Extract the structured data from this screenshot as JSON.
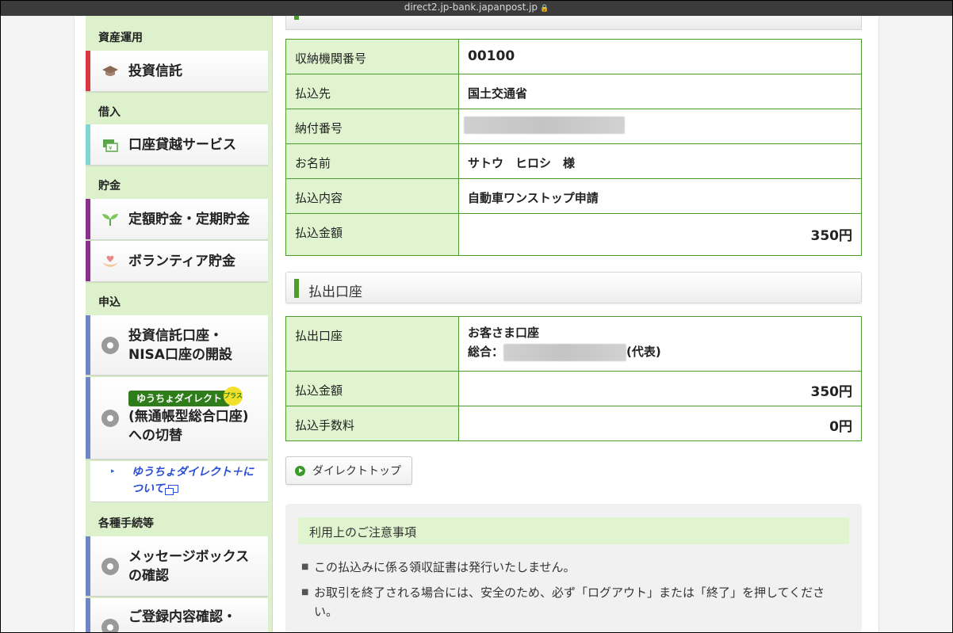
{
  "browser": {
    "url": "direct2.jp-bank.japanpost.jp"
  },
  "sidebar": {
    "sections": {
      "investment": "資産運用",
      "loan": "借入",
      "savings": "貯金",
      "apply": "申込",
      "procedures": "各種手続等"
    },
    "items": {
      "investment_trust": "投資信託",
      "overdraft": "口座貸越サービス",
      "fixed_savings": "定額貯金・定期貯金",
      "volunteer_savings": "ボランティア貯金",
      "open_account_1": "投資信託口座・",
      "open_account_2": "NISA口座の開設",
      "badge": "ゆうちょダイレクト",
      "badge_plus": "プラス",
      "switch_1": "(無通帳型総合口座)",
      "switch_2": "への切替",
      "about_link_1": "ゆうちょダイレクト＋に",
      "about_link_2": "ついて",
      "message_1": "メッセージボックス",
      "message_2": "の確認",
      "registration": "ご登録内容確認・"
    },
    "colors": {
      "investment_bar": "#d8383f",
      "loan_bar": "#7fd6d6",
      "savings_bar": "#8a2f8f",
      "apply_bar": "#6f86c6",
      "procedures_bar": "#6f86c6"
    }
  },
  "payment_table": {
    "rows": [
      {
        "label": "収納機関番号",
        "value": "00100"
      },
      {
        "label": "払込先",
        "value": "国土交通省"
      },
      {
        "label": "納付番号",
        "value": ""
      },
      {
        "label": "お名前",
        "value": "サトウ　ヒロシ　様"
      },
      {
        "label": "払込内容",
        "value": "自動車ワンストップ申請"
      },
      {
        "label": "払込金額",
        "value": "350円"
      }
    ]
  },
  "account_section": {
    "title": "払出口座",
    "rows": [
      {
        "label": "払出口座",
        "value": "お客さま口座",
        "sub_prefix": "総合：",
        "sub_suffix": "(代表)"
      },
      {
        "label": "払込金額",
        "value": "350円"
      },
      {
        "label": "払込手数料",
        "value": "0円"
      }
    ]
  },
  "buttons": {
    "direct_top": "ダイレクトトップ"
  },
  "notice": {
    "title": "利用上のご注意事項",
    "items": [
      "この払込みに係る領収証書は発行いたしません。",
      "お取引を終了される場合には、安全のため、必ず「ログアウト」または「終了」を押してください。"
    ]
  }
}
